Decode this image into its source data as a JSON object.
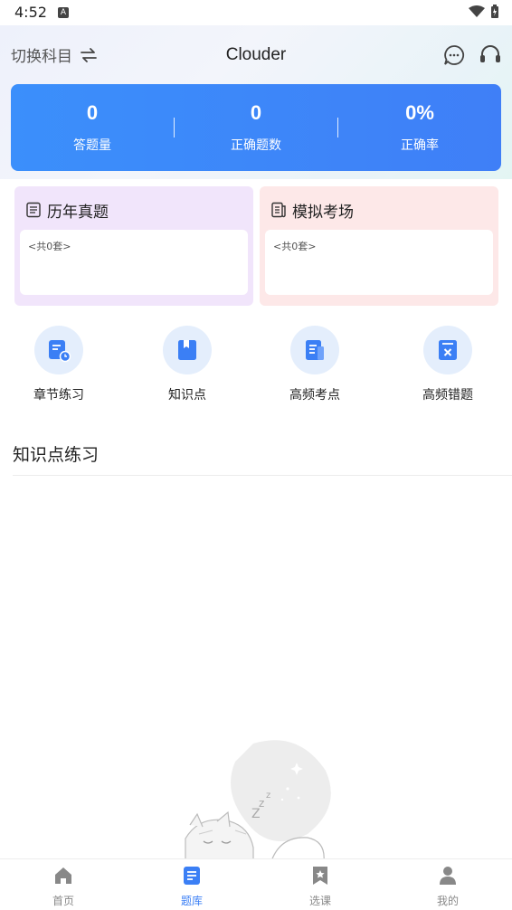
{
  "status_bar": {
    "time": "4:52",
    "notification_badge": "A"
  },
  "header": {
    "switch_subject_label": "切换科目",
    "app_title": "Clouder",
    "icons": [
      "swap-icon",
      "chat-icon",
      "headset-icon"
    ]
  },
  "stats": [
    {
      "value": "0",
      "label": "答题量"
    },
    {
      "value": "0",
      "label": "正确题数"
    },
    {
      "value": "0%",
      "label": "正确率"
    }
  ],
  "exam_cards": {
    "history": {
      "title": "历年真题",
      "count_text": "<共0套>"
    },
    "mock": {
      "title": "模拟考场",
      "count_text": "<共0套>"
    }
  },
  "quick_actions": [
    {
      "label": "章节练习",
      "icon": "chapter-practice-icon"
    },
    {
      "label": "知识点",
      "icon": "knowledge-book-icon"
    },
    {
      "label": "高频考点",
      "icon": "frequent-topic-icon"
    },
    {
      "label": "高频错题",
      "icon": "frequent-error-icon"
    }
  ],
  "section": {
    "title": "知识点练习"
  },
  "tab_bar": {
    "tabs": [
      {
        "label": "首页",
        "icon": "home-icon",
        "active": false
      },
      {
        "label": "题库",
        "icon": "question-bank-icon",
        "active": true
      },
      {
        "label": "选课",
        "icon": "bookmark-star-icon",
        "active": false
      },
      {
        "label": "我的",
        "icon": "user-icon",
        "active": false
      }
    ]
  },
  "colors": {
    "accent": "#3b7ff5",
    "stats_card": "#3d86f9",
    "history_card_bg": "#f1e5fb",
    "mock_card_bg": "#fde8e8",
    "icon_circle_bg": "#e4eefc",
    "tab_inactive": "#888888"
  }
}
